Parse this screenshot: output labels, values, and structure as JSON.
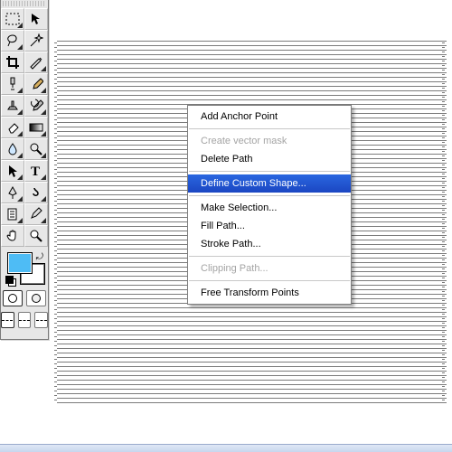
{
  "tools": {
    "rows": [
      [
        "rect-marquee-icon",
        "move-icon"
      ],
      [
        "lasso-icon",
        "magic-wand-icon"
      ],
      [
        "crop-icon",
        "slice-icon"
      ],
      [
        "healing-brush-icon",
        "brush-icon"
      ],
      [
        "clone-stamp-icon",
        "history-brush-icon"
      ],
      [
        "eraser-icon",
        "gradient-icon"
      ],
      [
        "blur-icon",
        "dodge-icon"
      ],
      [
        "path-select-icon",
        "type-icon"
      ],
      [
        "pen-icon",
        "custom-shape-icon"
      ],
      [
        "notes-icon",
        "eyedropper-icon"
      ],
      [
        "hand-icon",
        "zoom-icon"
      ]
    ]
  },
  "colors": {
    "foreground": "#4ebcf5",
    "background": "#ffffff"
  },
  "context_menu": {
    "items": [
      {
        "label": "Add Anchor Point",
        "enabled": true,
        "hl": false
      },
      {
        "sep": true
      },
      {
        "label": "Create vector mask",
        "enabled": false,
        "hl": false
      },
      {
        "label": "Delete Path",
        "enabled": true,
        "hl": false
      },
      {
        "sep": true
      },
      {
        "label": "Define Custom Shape...",
        "enabled": true,
        "hl": true
      },
      {
        "sep": true
      },
      {
        "label": "Make Selection...",
        "enabled": true,
        "hl": false
      },
      {
        "label": "Fill Path...",
        "enabled": true,
        "hl": false
      },
      {
        "label": "Stroke Path...",
        "enabled": true,
        "hl": false
      },
      {
        "sep": true
      },
      {
        "label": "Clipping Path...",
        "enabled": false,
        "hl": false
      },
      {
        "sep": true
      },
      {
        "label": "Free Transform Points",
        "enabled": true,
        "hl": false
      }
    ]
  }
}
